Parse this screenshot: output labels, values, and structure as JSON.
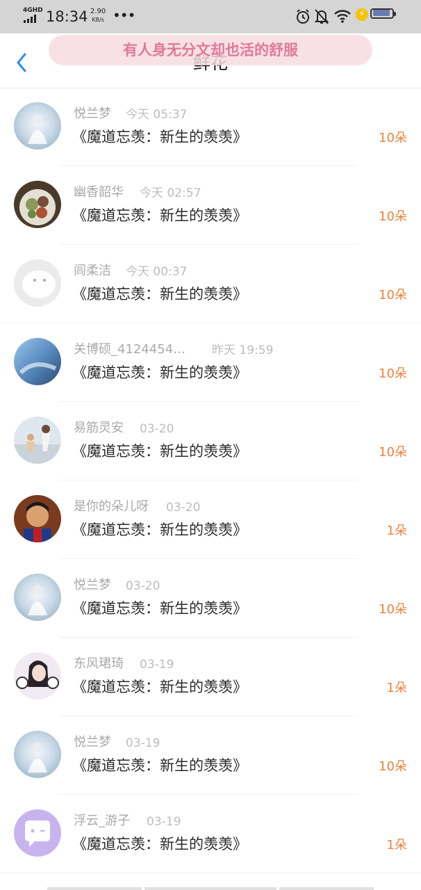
{
  "status_bar": {
    "network": "4GHD",
    "time": "18:34",
    "speed_value": "2.90",
    "speed_unit": "KB/s",
    "dots": "•••"
  },
  "header": {
    "title": "鲜花",
    "toast": "有人身无分文却也活的舒服"
  },
  "icons": {
    "back": "chevron-left-icon",
    "alarm": "alarm-icon",
    "mute": "bell-off-icon",
    "wifi": "wifi-icon",
    "charge": "charging-icon",
    "battery": "battery-icon"
  },
  "colors": {
    "accent_blue": "#2b8df0",
    "count_orange": "#f0803a",
    "toast_pink": "#e0799a"
  },
  "items": [
    {
      "name": "悦兰梦",
      "time": "今天 05:37",
      "book": "《魔道忘羡：新生的羡羡》",
      "count": "10朵"
    },
    {
      "name": "幽香韶华",
      "time": "今天 02:57",
      "book": "《魔道忘羡：新生的羡羡》",
      "count": "10朵"
    },
    {
      "name": "闾柔洁",
      "time": "今天 00:37",
      "book": "《魔道忘羡：新生的羡羡》",
      "count": "10朵"
    },
    {
      "name": "关博硕_4124454…",
      "time": "昨天 19:59",
      "book": "《魔道忘羡：新生的羡羡》",
      "count": "10朵"
    },
    {
      "name": "易筋灵安",
      "time": "03-20",
      "book": "《魔道忘羡：新生的羡羡》",
      "count": "10朵"
    },
    {
      "name": "是你的朵儿呀",
      "time": "03-20",
      "book": "《魔道忘羡：新生的羡羡》",
      "count": "1朵"
    },
    {
      "name": "悦兰梦",
      "time": "03-20",
      "book": "《魔道忘羡：新生的羡羡》",
      "count": "10朵"
    },
    {
      "name": "东风珺琦",
      "time": "03-19",
      "book": "《魔道忘羡：新生的羡羡》",
      "count": "1朵"
    },
    {
      "name": "悦兰梦",
      "time": "03-19",
      "book": "《魔道忘羡：新生的羡羡》",
      "count": "10朵"
    },
    {
      "name": "浮云_游子",
      "time": "03-19",
      "book": "《魔道忘羡：新生的羡羡》",
      "count": "1朵"
    }
  ]
}
